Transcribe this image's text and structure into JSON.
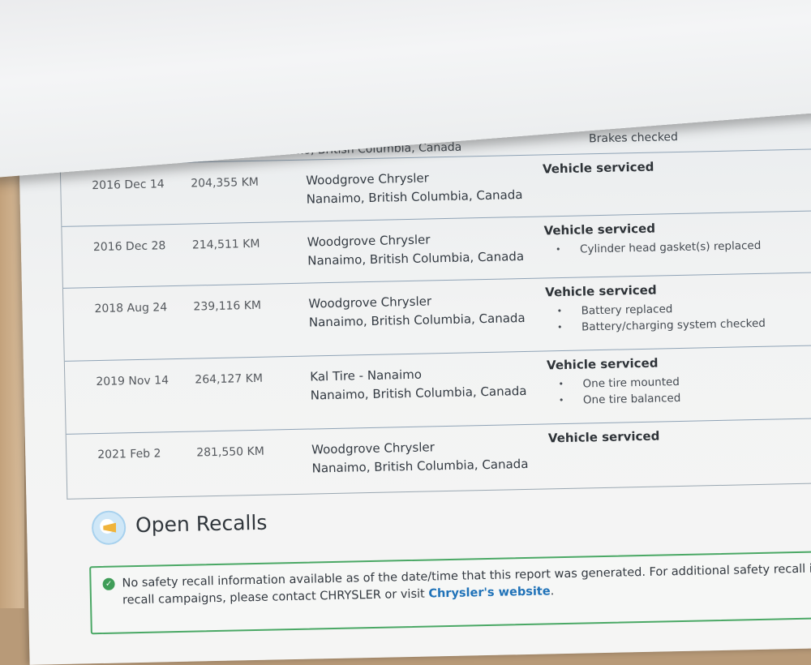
{
  "history": {
    "partial": {
      "location": "Nanaimo, British Columbia, Canada",
      "item": "Brakes checked"
    },
    "rows": [
      {
        "date": "2016 Dec 14",
        "odometer": "204,355 KM",
        "source": "Woodgrove Chrysler",
        "location": "Nanaimo, British Columbia, Canada",
        "title": "Vehicle serviced",
        "items": []
      },
      {
        "date": "2016 Dec 28",
        "odometer": "214,511 KM",
        "source": "Woodgrove Chrysler",
        "location": "Nanaimo, British Columbia, Canada",
        "title": "Vehicle serviced",
        "items": [
          "Cylinder head gasket(s) replaced"
        ]
      },
      {
        "date": "2018 Aug 24",
        "odometer": "239,116 KM",
        "source": "Woodgrove Chrysler",
        "location": "Nanaimo, British Columbia, Canada",
        "title": "Vehicle serviced",
        "items": [
          "Battery replaced",
          "Battery/charging system checked"
        ]
      },
      {
        "date": "2019 Nov 14",
        "odometer": "264,127 KM",
        "source": "Kal Tire - Nanaimo",
        "location": "Nanaimo, British Columbia, Canada",
        "title": "Vehicle serviced",
        "items": [
          "One tire mounted",
          "One tire balanced"
        ]
      },
      {
        "date": "2021 Feb 2",
        "odometer": "281,550 KM",
        "source": "Woodgrove Chrysler",
        "location": "Nanaimo, British Columbia, Canada",
        "title": "Vehicle serviced",
        "items": []
      }
    ]
  },
  "recalls": {
    "heading": "Open Recalls",
    "icon": "megaphone-icon",
    "notice_line1": "No safety recall information available as of the date/time that this report was generated. For additional safety recall inform",
    "notice_line2_prefix": "recall campaigns, please contact CHRYSLER or visit ",
    "link_text": "Chrysler's website",
    "notice_line2_suffix": "."
  }
}
